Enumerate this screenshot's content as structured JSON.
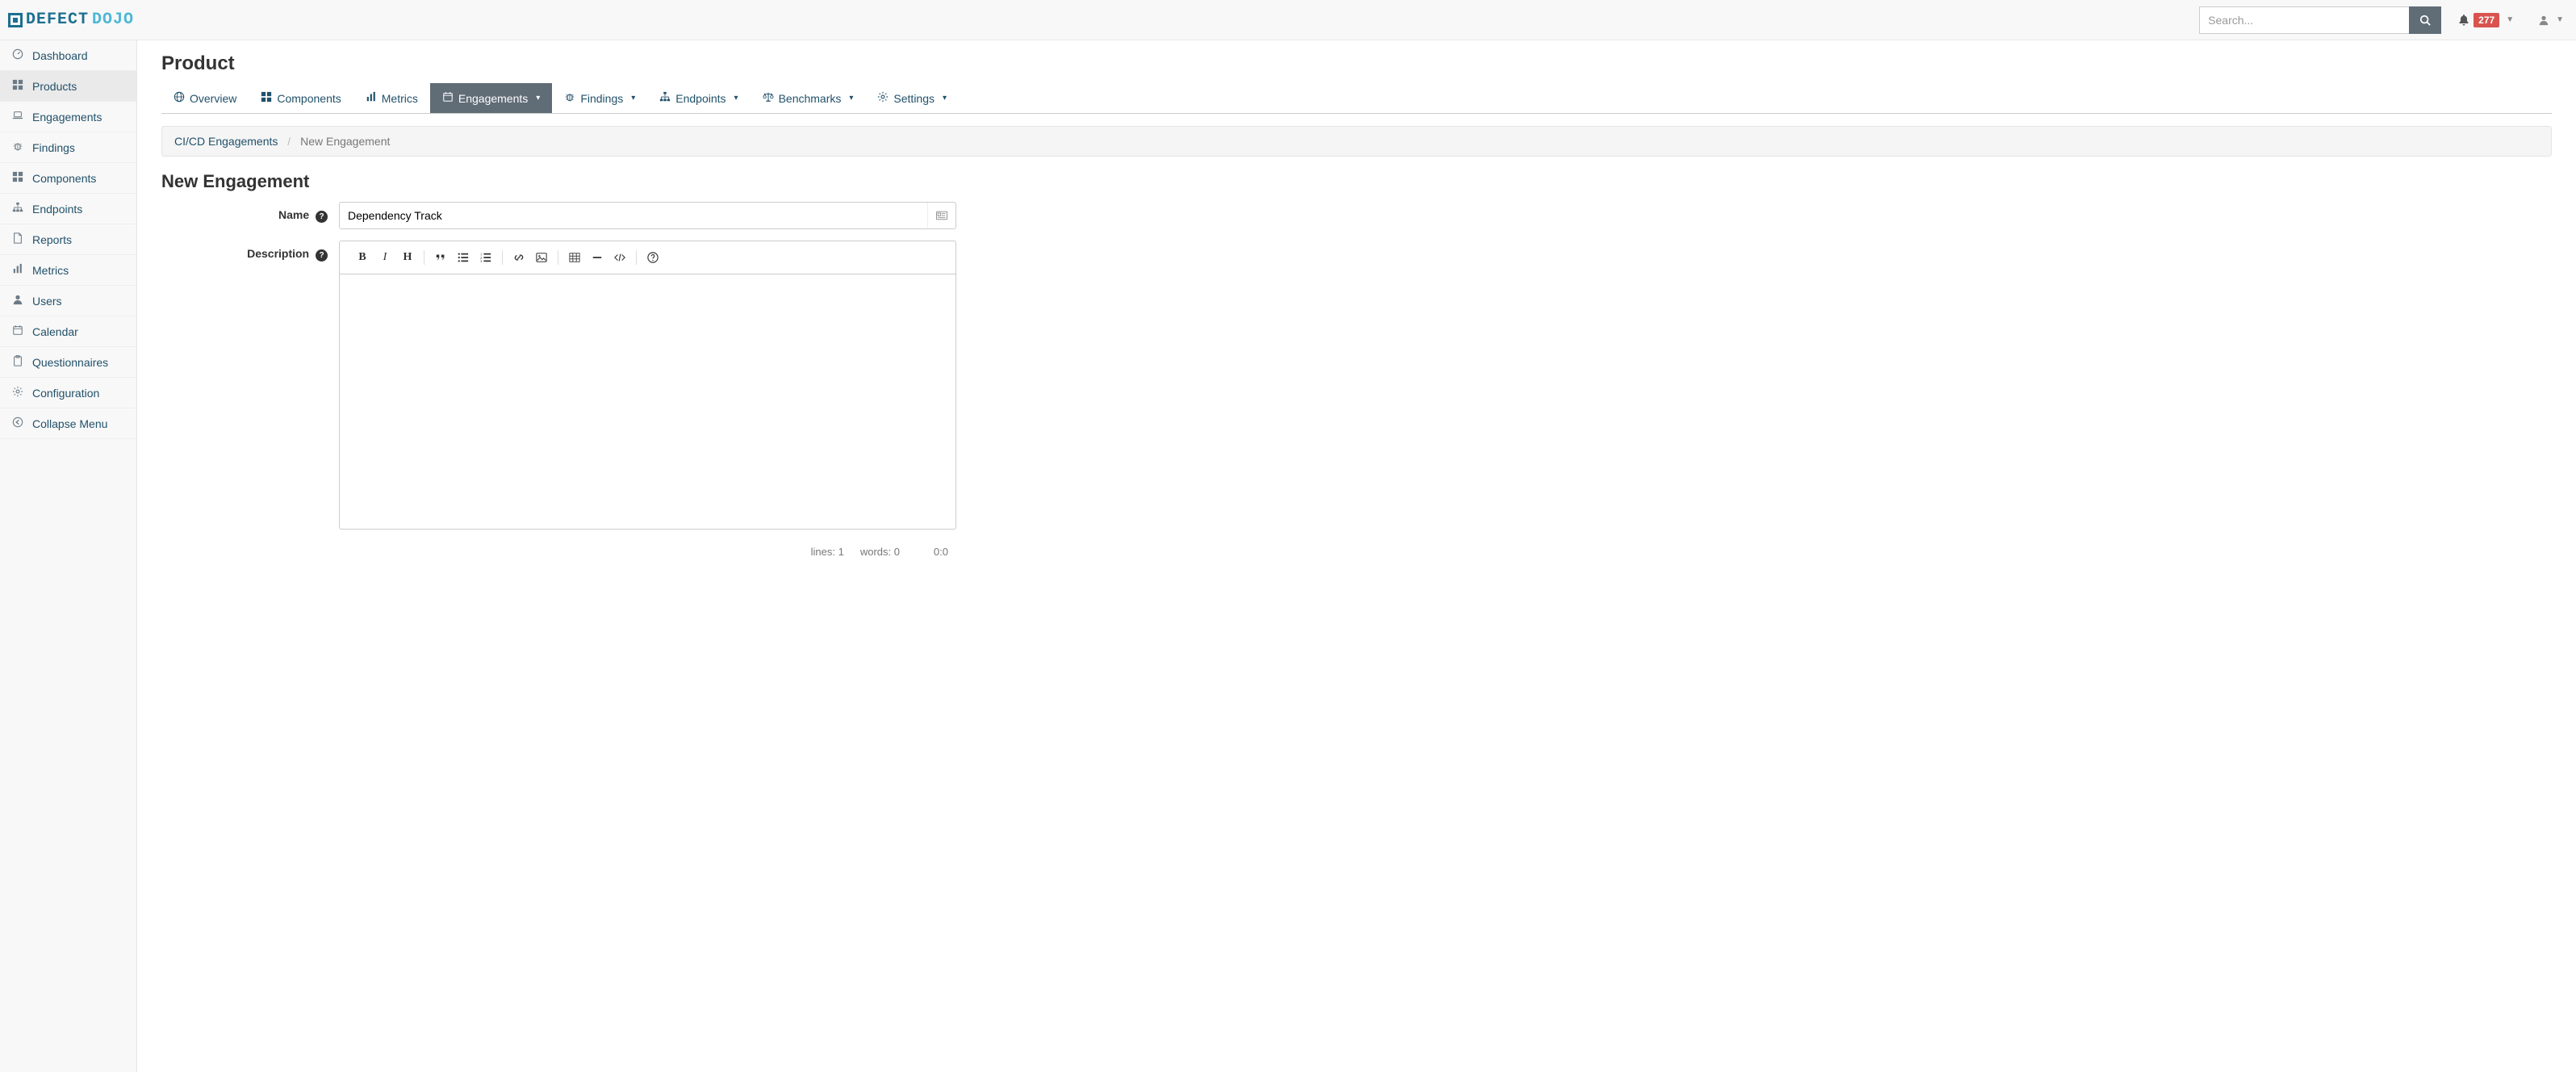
{
  "brand": {
    "part1": "DEFECT",
    "part2": "DOJO"
  },
  "search": {
    "placeholder": "Search..."
  },
  "notifications": {
    "count": "277"
  },
  "sidebar": {
    "items": [
      {
        "label": "Dashboard",
        "icon": "dashboard"
      },
      {
        "label": "Products",
        "icon": "grid",
        "active": true
      },
      {
        "label": "Engagements",
        "icon": "laptop"
      },
      {
        "label": "Findings",
        "icon": "bug"
      },
      {
        "label": "Components",
        "icon": "th"
      },
      {
        "label": "Endpoints",
        "icon": "sitemap"
      },
      {
        "label": "Reports",
        "icon": "file"
      },
      {
        "label": "Metrics",
        "icon": "chart"
      },
      {
        "label": "Users",
        "icon": "user"
      },
      {
        "label": "Calendar",
        "icon": "calendar"
      },
      {
        "label": "Questionnaires",
        "icon": "clipboard"
      },
      {
        "label": "Configuration",
        "icon": "gear"
      },
      {
        "label": "Collapse Menu",
        "icon": "collapse"
      }
    ]
  },
  "page": {
    "title": "Product",
    "tabs": [
      {
        "label": "Overview",
        "icon": "globe"
      },
      {
        "label": "Components",
        "icon": "th"
      },
      {
        "label": "Metrics",
        "icon": "chart"
      },
      {
        "label": "Engagements",
        "icon": "calendar",
        "active": true,
        "caret": true
      },
      {
        "label": "Findings",
        "icon": "bug",
        "caret": true
      },
      {
        "label": "Endpoints",
        "icon": "sitemap",
        "caret": true
      },
      {
        "label": "Benchmarks",
        "icon": "balance",
        "caret": true
      },
      {
        "label": "Settings",
        "icon": "gear",
        "caret": true
      }
    ],
    "breadcrumb": {
      "parent": "CI/CD Engagements",
      "sep": "/",
      "current": "New Engagement"
    },
    "section_title": "New Engagement"
  },
  "form": {
    "name_label": "Name",
    "name_value": "Dependency Track",
    "description_label": "Description"
  },
  "editor": {
    "lines_label": "lines:",
    "lines_value": "1",
    "words_label": "words:",
    "words_value": "0",
    "cursor": "0:0"
  }
}
